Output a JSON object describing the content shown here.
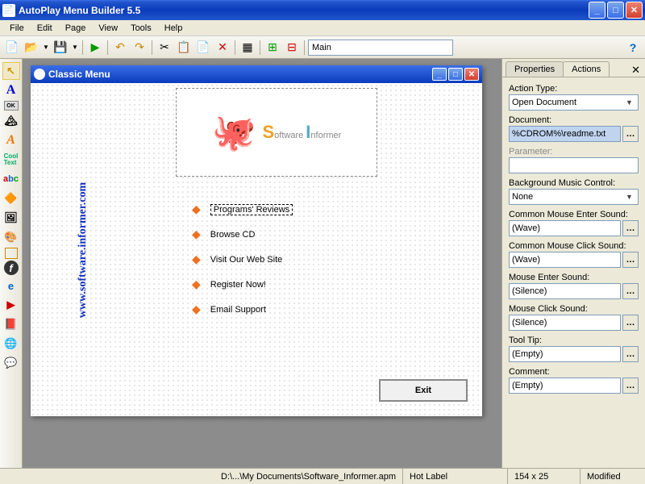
{
  "titlebar": {
    "title": "AutoPlay Menu Builder 5.5"
  },
  "menubar": {
    "items": [
      "File",
      "Edit",
      "Page",
      "View",
      "Tools",
      "Help"
    ]
  },
  "toolbar": {
    "page_combo": "Main"
  },
  "design_window": {
    "title": "Classic Menu",
    "sidebar_url": "www.software.informer.com",
    "logo_text_1": "S",
    "logo_text_2": "oftware ",
    "logo_text_3": "I",
    "logo_text_4": "nformer",
    "items": [
      {
        "label": "Programs' Reviews",
        "selected": true
      },
      {
        "label": "Browse CD",
        "selected": false
      },
      {
        "label": "Visit Our Web Site",
        "selected": false
      },
      {
        "label": "Register Now!",
        "selected": false
      },
      {
        "label": "Email Support",
        "selected": false
      }
    ],
    "exit_label": "Exit"
  },
  "right_panel": {
    "tabs": {
      "properties": "Properties",
      "actions": "Actions"
    },
    "fields": {
      "action_type": {
        "label": "Action Type:",
        "value": "Open Document"
      },
      "document": {
        "label": "Document:",
        "value": "%CDROM%\\readme.txt"
      },
      "parameter": {
        "label": "Parameter:",
        "value": ""
      },
      "bg_music": {
        "label": "Background Music Control:",
        "value": "None"
      },
      "enter_sound_common": {
        "label": "Common Mouse Enter Sound:",
        "value": "(Wave)"
      },
      "click_sound_common": {
        "label": "Common Mouse Click Sound:",
        "value": "(Wave)"
      },
      "enter_sound": {
        "label": "Mouse Enter Sound:",
        "value": "(Silence)"
      },
      "click_sound": {
        "label": "Mouse Click Sound:",
        "value": "(Silence)"
      },
      "tooltip": {
        "label": "Tool Tip:",
        "value": "(Empty)"
      },
      "comment": {
        "label": "Comment:",
        "value": "(Empty)"
      }
    }
  },
  "statusbar": {
    "path": "D:\\...\\My Documents\\Software_Informer.apm",
    "element": "Hot Label",
    "size": "154 x 25",
    "state": "Modified"
  }
}
